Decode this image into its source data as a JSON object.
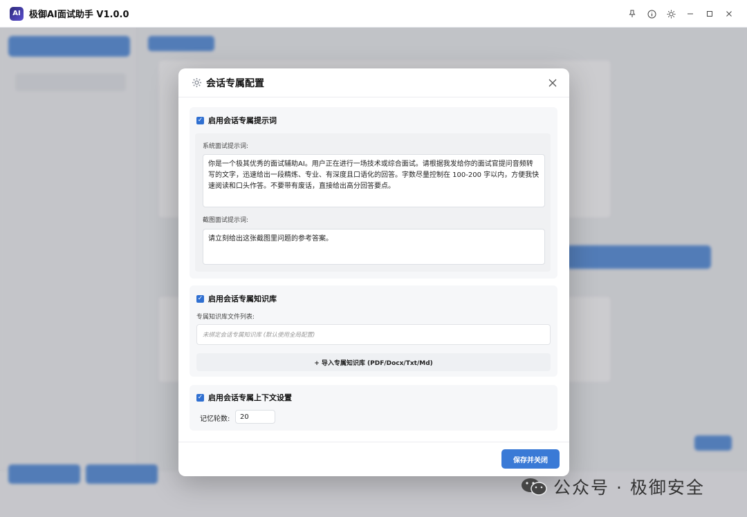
{
  "app": {
    "title": "极御AI面试助手 V1.0.0",
    "logo_text": "AI"
  },
  "window_controls": [
    "pin-icon",
    "info-icon",
    "sun-icon",
    "minimize-icon",
    "maximize-icon",
    "close-icon"
  ],
  "modal": {
    "title": "会话专属配置",
    "prompt_section": {
      "checkbox_label": "启用会话专属提示词",
      "checked": true,
      "system_prompt_label": "系统面试提示词:",
      "system_prompt_value": "你是一个极其优秀的面试辅助AI。用户正在进行一场技术或综合面试。请根据我发给你的面试官提问音频转写的文字，迅速给出一段精炼、专业、有深度且口语化的回答。字数尽量控制在 100-200 字以内，方便我快速阅读和口头作答。不要带有废话，直接给出高分回答要点。",
      "screenshot_prompt_label": "截图面试提示词:",
      "screenshot_prompt_value": "请立刻给出这张截图里问题的参考答案。"
    },
    "knowledge_section": {
      "checkbox_label": "启用会话专属知识库",
      "checked": true,
      "file_list_label": "专属知识库文件列表:",
      "file_list_placeholder": "未绑定会话专属知识库 (默认使用全局配置)",
      "import_label": "+ 导入专属知识库 (PDF/Docx/Txt/Md)"
    },
    "context_section": {
      "checkbox_label": "启用会话专属上下文设置",
      "checked": true,
      "memory_label": "记忆轮数:",
      "memory_value": "20"
    },
    "save_label": "保存并关闭"
  },
  "watermark": {
    "text": "公众号 · 极御安全"
  },
  "colors": {
    "accent": "#3a7ad6",
    "checkbox": "#2f6fd1"
  }
}
